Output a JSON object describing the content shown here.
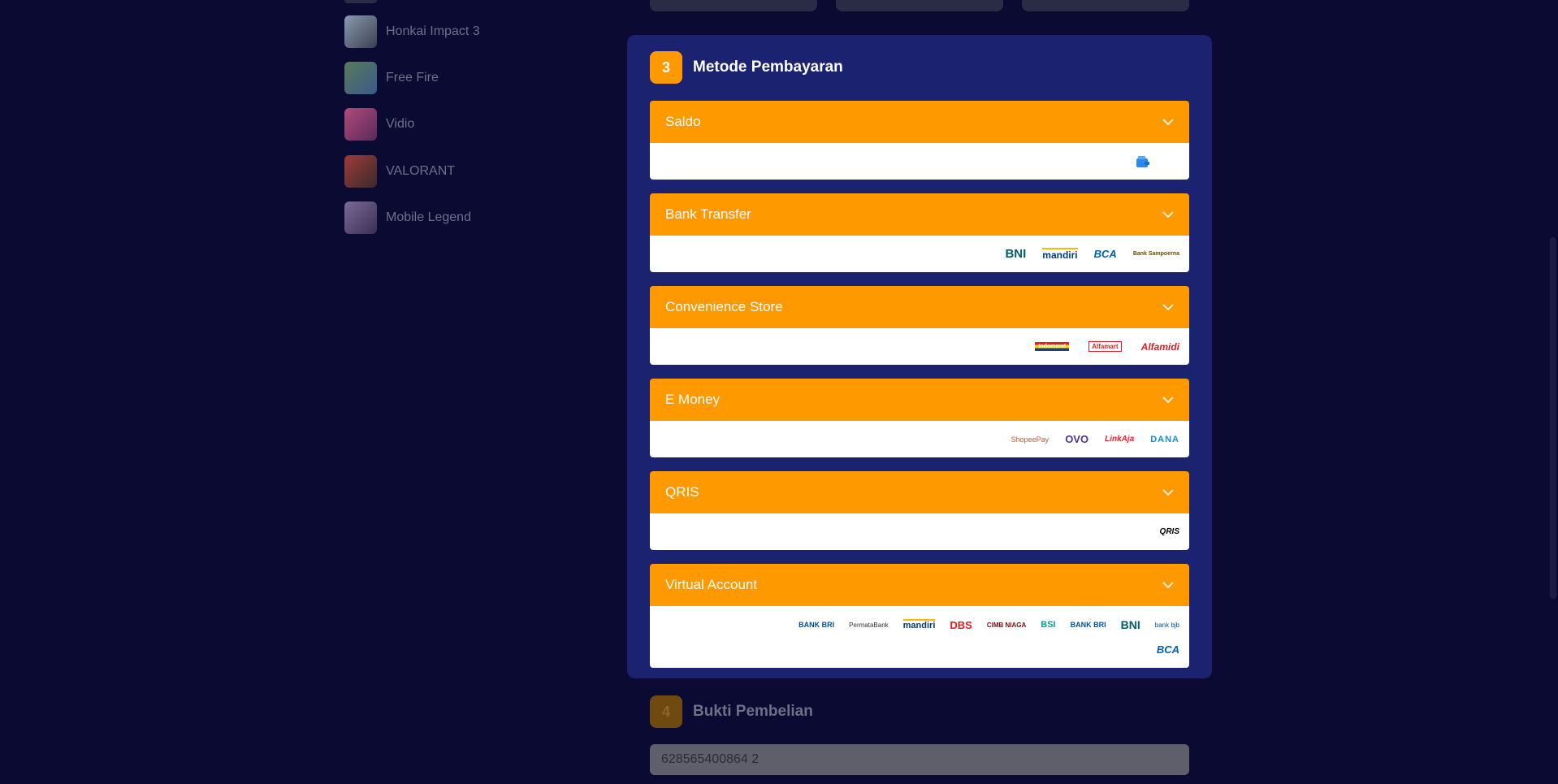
{
  "sidebar": {
    "games": [
      {
        "label": "Honkai Impact 3",
        "thumb_color": "#8a9ab0"
      },
      {
        "label": "Free Fire",
        "thumb_color": "#6a8a5a"
      },
      {
        "label": "Vidio",
        "thumb_color": "#a04a7a"
      },
      {
        "label": "VALORANT",
        "thumb_color": "#a03a3a"
      },
      {
        "label": "Mobile Legend",
        "thumb_color": "#6a5a8a"
      }
    ]
  },
  "step3": {
    "number": "3",
    "title": "Metode Pembayaran",
    "methods": [
      {
        "label": "Saldo",
        "logos": []
      },
      {
        "label": "Bank Transfer",
        "logos": [
          "BNI",
          "mandiri",
          "BCA",
          "Bank Sampoerna"
        ]
      },
      {
        "label": "Convenience Store",
        "logos": [
          "Indomaret",
          "Alfamart",
          "Alfamidi"
        ]
      },
      {
        "label": "E Money",
        "logos": [
          "ShopeePay",
          "OVO",
          "LinkAja",
          "DANA"
        ]
      },
      {
        "label": "QRIS",
        "logos": [
          "QRIS"
        ]
      },
      {
        "label": "Virtual Account",
        "logos": [
          "BANK BRI",
          "PermataBank",
          "mandiri",
          "DBS",
          "CIMB NIAGA",
          "BSI",
          "BANK BRI",
          "BNI",
          "bank bjb",
          "BCA"
        ]
      }
    ]
  },
  "step4": {
    "number": "4",
    "title": "Bukti Pembelian",
    "phone_value": "628565400864 2"
  },
  "colors": {
    "accent": "#ff9900",
    "panel": "#1b2270",
    "background": "#0a0a33"
  }
}
